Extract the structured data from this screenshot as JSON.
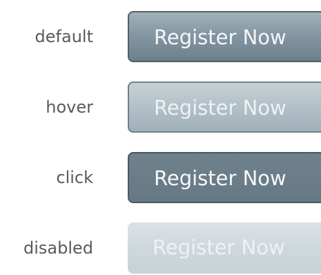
{
  "states": [
    {
      "label": "default",
      "button_text": "Register Now"
    },
    {
      "label": "hover",
      "button_text": "Register Now"
    },
    {
      "label": "click",
      "button_text": "Register Now"
    },
    {
      "label": "disabled",
      "button_text": "Register Now"
    }
  ],
  "colors": {
    "default_button": "#8597a2",
    "hover_button": "#b2c0c7",
    "click_button": "#6b7d88",
    "disabled_button": "#cfd8dd",
    "state_label_text": "#5a5a5a"
  }
}
